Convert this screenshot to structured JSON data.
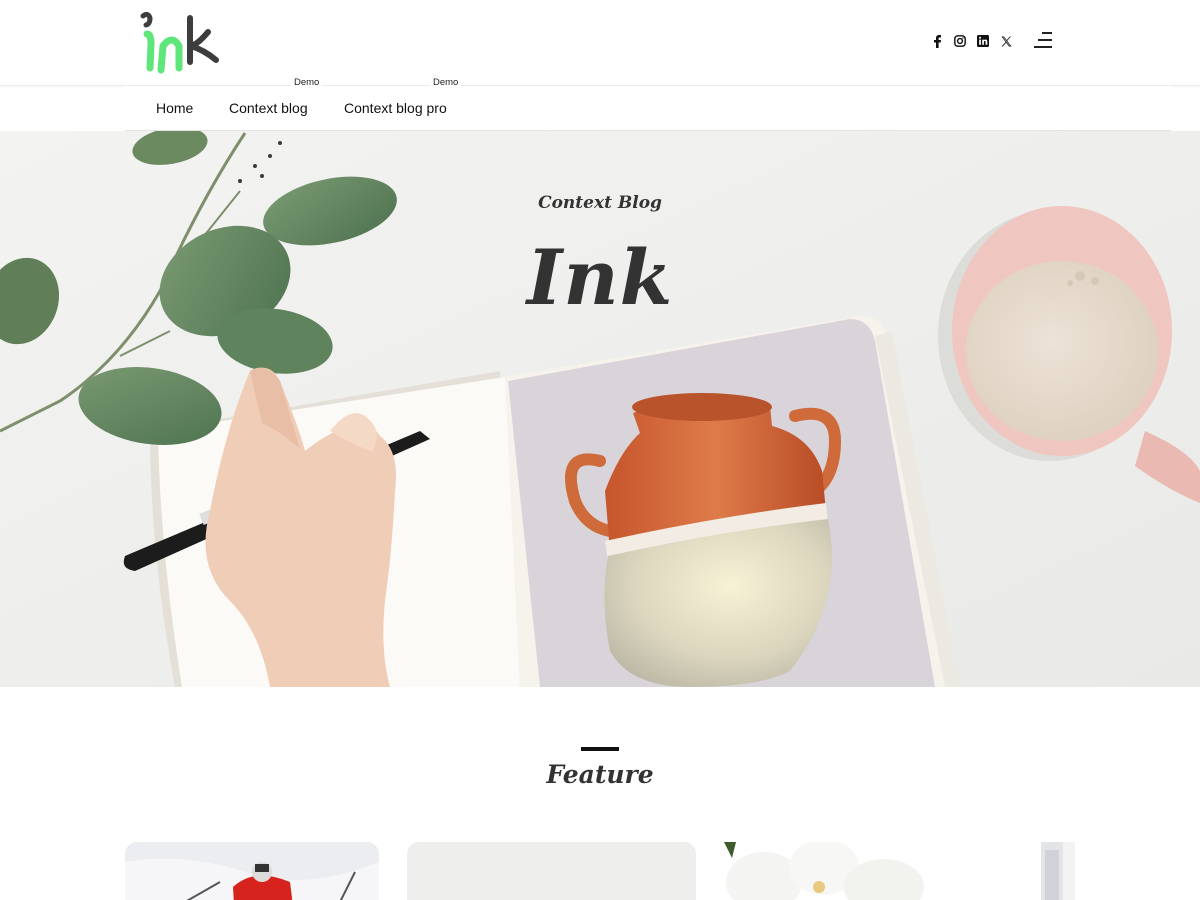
{
  "header": {
    "logo_text": "ink",
    "social": [
      {
        "name": "facebook-icon",
        "glyph": "f"
      },
      {
        "name": "instagram-icon",
        "glyph": "ig"
      },
      {
        "name": "linkedin-icon",
        "glyph": "in"
      },
      {
        "name": "x-twitter-icon",
        "glyph": "𝕏"
      }
    ]
  },
  "nav": {
    "items": [
      {
        "label": "Home"
      },
      {
        "label": "Context blog",
        "badge": "Demo"
      },
      {
        "label": "Context blog pro",
        "badge": "Demo"
      }
    ]
  },
  "hero": {
    "subtitle": "Context Blog",
    "title": "Ink"
  },
  "feature": {
    "title": "Feature"
  },
  "colors": {
    "logo_green": "#5ee67a",
    "logo_dark": "#3d3d3d",
    "text_dark": "#333333",
    "hero_bg": "#f1f1ef"
  }
}
